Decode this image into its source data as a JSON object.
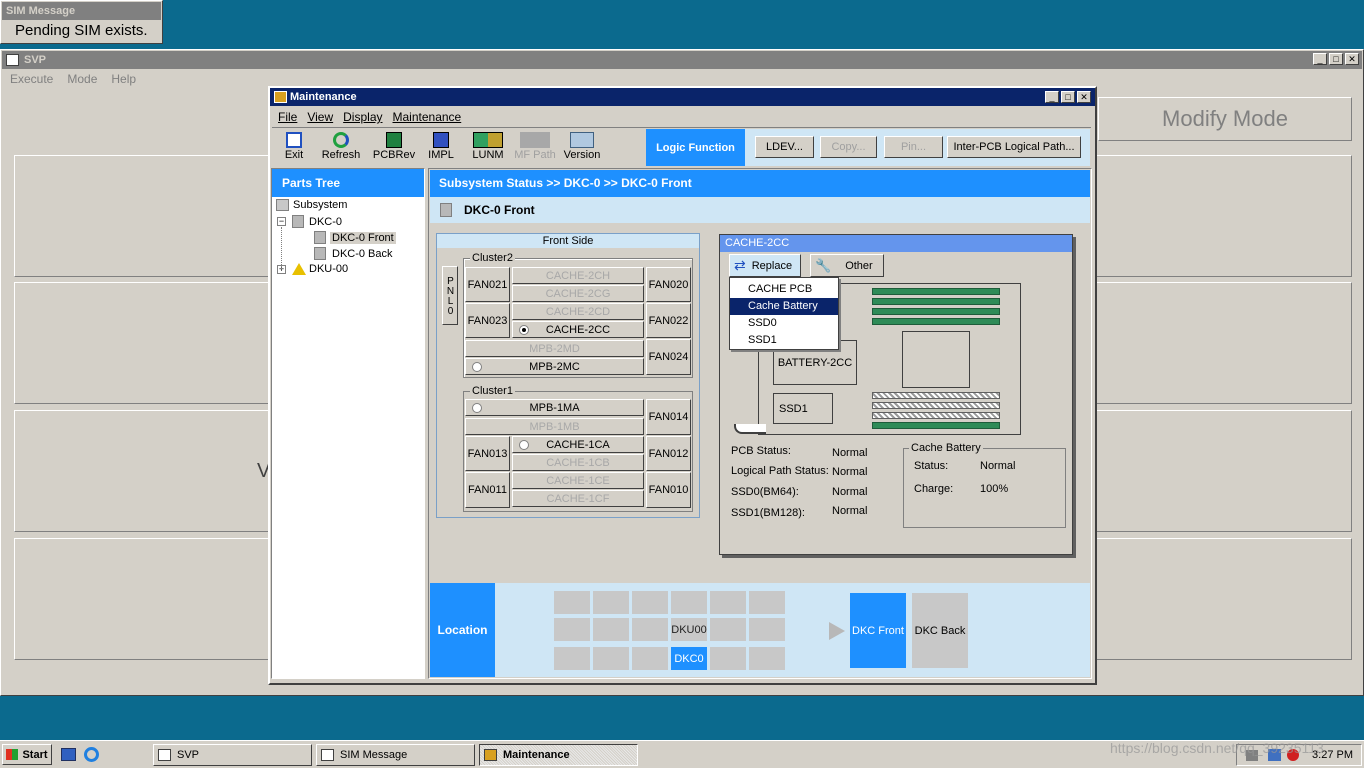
{
  "sim_popup": {
    "title": "SIM Message",
    "text": "Pending SIM exists."
  },
  "svp": {
    "title": "SVP",
    "menu": [
      "Execute",
      "Mode",
      "Help"
    ],
    "modify_mode": "Modify Mode",
    "partial_letter": "V"
  },
  "maint": {
    "title": "Maintenance",
    "menu": [
      "File",
      "View",
      "Display",
      "Maintenance"
    ],
    "toolbar": [
      {
        "label": "Exit",
        "icon": "exit-icon",
        "enabled": true
      },
      {
        "label": "Refresh",
        "icon": "refresh-icon",
        "enabled": true
      },
      {
        "label": "PCBRev",
        "icon": "pcbrev-icon",
        "enabled": true
      },
      {
        "label": "IMPL",
        "icon": "impl-icon",
        "enabled": true
      },
      {
        "label": "LUNM",
        "icon": "lunm-icon",
        "enabled": true
      },
      {
        "label": "MF Path",
        "icon": "mf-path-icon",
        "enabled": false
      },
      {
        "label": "Version",
        "icon": "version-icon",
        "enabled": true
      }
    ],
    "logic_function": "Logic Function",
    "logic_buttons": [
      {
        "label": "LDEV...",
        "enabled": true
      },
      {
        "label": "Copy...",
        "enabled": false
      },
      {
        "label": "Pin...",
        "enabled": false
      },
      {
        "label": "Inter-PCB Logical Path...",
        "enabled": true
      }
    ],
    "parts_tree": {
      "title": "Parts Tree",
      "nodes": [
        {
          "label": "Subsystem",
          "icon": "subsystem-icon"
        },
        {
          "label": "DKC-0",
          "icon": "cabinet-icon"
        },
        {
          "label": "DKC-0 Front",
          "icon": "cabinet-icon"
        },
        {
          "label": "DKC-0 Back",
          "icon": "cabinet-icon"
        },
        {
          "label": "DKU-00",
          "icon": "warning-icon"
        }
      ]
    },
    "breadcrumb": "Subsystem Status >> DKC-0 >> DKC-0 Front",
    "page_title": "DKC-0 Front",
    "front_side": {
      "title": "Front Side",
      "pnl": "PNL0",
      "cluster2": {
        "title": "Cluster2",
        "fans": [
          "FAN021",
          "FAN023",
          "FAN020",
          "FAN022",
          "FAN024"
        ],
        "slots": [
          "CACHE-2CH",
          "CACHE-2CG",
          "CACHE-2CD",
          "CACHE-2CC",
          "MPB-2MD",
          "MPB-2MC"
        ]
      },
      "cluster1": {
        "title": "Cluster1",
        "fans": [
          "FAN014",
          "FAN013",
          "FAN012",
          "FAN011",
          "FAN010"
        ],
        "slots": [
          "MPB-1MA",
          "MPB-1MB",
          "CACHE-1CA",
          "CACHE-1CB",
          "CACHE-1CE",
          "CACHE-1CF"
        ]
      }
    },
    "detail": {
      "title": "CACHE-2CC",
      "replace": "Replace",
      "other": "Other",
      "dropdown": [
        "CACHE PCB",
        "Cache Battery",
        "SSD0",
        "SSD1"
      ],
      "dropdown_selected": "Cache Battery",
      "battery_label": "BATTERY-2CC",
      "ssd1_label": "SSD1",
      "status": [
        {
          "label": "PCB Status:",
          "value": "Normal"
        },
        {
          "label": "Logical Path Status:",
          "value": "Normal"
        },
        {
          "label": "SSD0(BM64):",
          "value": "Normal"
        },
        {
          "label": "SSD1(BM128):",
          "value": "Normal"
        }
      ],
      "battery_group": {
        "title": "Cache Battery",
        "status_label": "Status:",
        "status_value": "Normal",
        "charge_label": "Charge:",
        "charge_value": "100%"
      }
    },
    "location": {
      "title": "Location",
      "dku_label": "DKU00",
      "dkc_label": "DKC0",
      "dkc_front": "DKC Front",
      "dkc_back": "DKC Back"
    }
  },
  "taskbar": {
    "start": "Start",
    "tasks": [
      "SVP",
      "SIM Message",
      "Maintenance"
    ],
    "active_task": "Maintenance",
    "clock": "3:27 PM",
    "watermark": "https://blog.csdn.net/qq_39235113"
  },
  "colors": {
    "accent": "#1e90ff",
    "title_bar": "#0a246a",
    "desktop": "#0b6a8e",
    "panel": "#cfe6f5"
  }
}
